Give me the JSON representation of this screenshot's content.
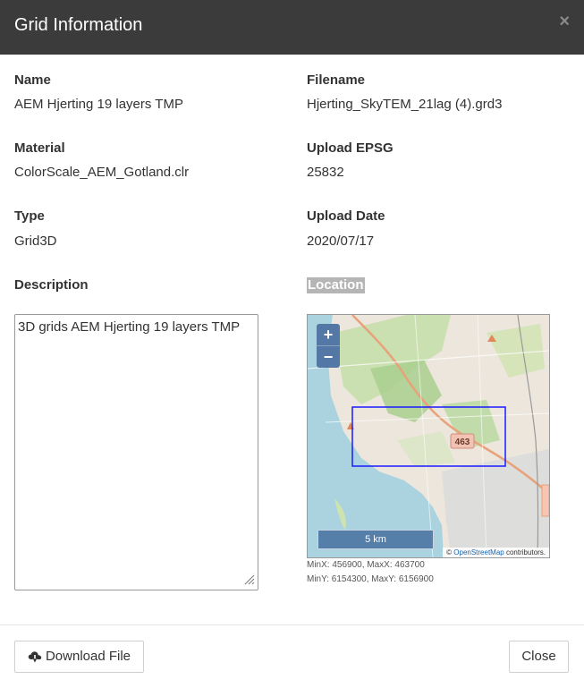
{
  "dialog": {
    "title": "Grid Information",
    "close_icon": "times-icon"
  },
  "fields": {
    "name": {
      "label": "Name",
      "value": "AEM Hjerting 19 layers TMP"
    },
    "filename": {
      "label": "Filename",
      "value": "Hjerting_SkyTEM_21lag (4).grd3"
    },
    "material": {
      "label": "Material",
      "value": "ColorScale_AEM_Gotland.clr"
    },
    "upload_epsg": {
      "label": "Upload EPSG",
      "value": "25832"
    },
    "type": {
      "label": "Type",
      "value": "Grid3D"
    },
    "upload_date": {
      "label": "Upload Date",
      "value": "2020/07/17"
    },
    "description": {
      "label": "Description",
      "value": "3D grids AEM Hjerting 19 layers TMP"
    },
    "location": {
      "label": "Location"
    }
  },
  "map": {
    "zoom_in": "+",
    "zoom_out": "−",
    "scale": "5 km",
    "road_label": "463",
    "attribution_symbol": "©",
    "attribution_link": "OpenStreetMap",
    "attribution_suffix": " contributors.",
    "extent_color": "#1a1aff"
  },
  "bounds": {
    "x": "MinX: 456900, MaxX: 463700",
    "y": "MinY: 6154300, MaxY: 6156900"
  },
  "footer": {
    "download_label": "Download File",
    "download_icon": "cloud-download-icon",
    "close_label": "Close"
  }
}
